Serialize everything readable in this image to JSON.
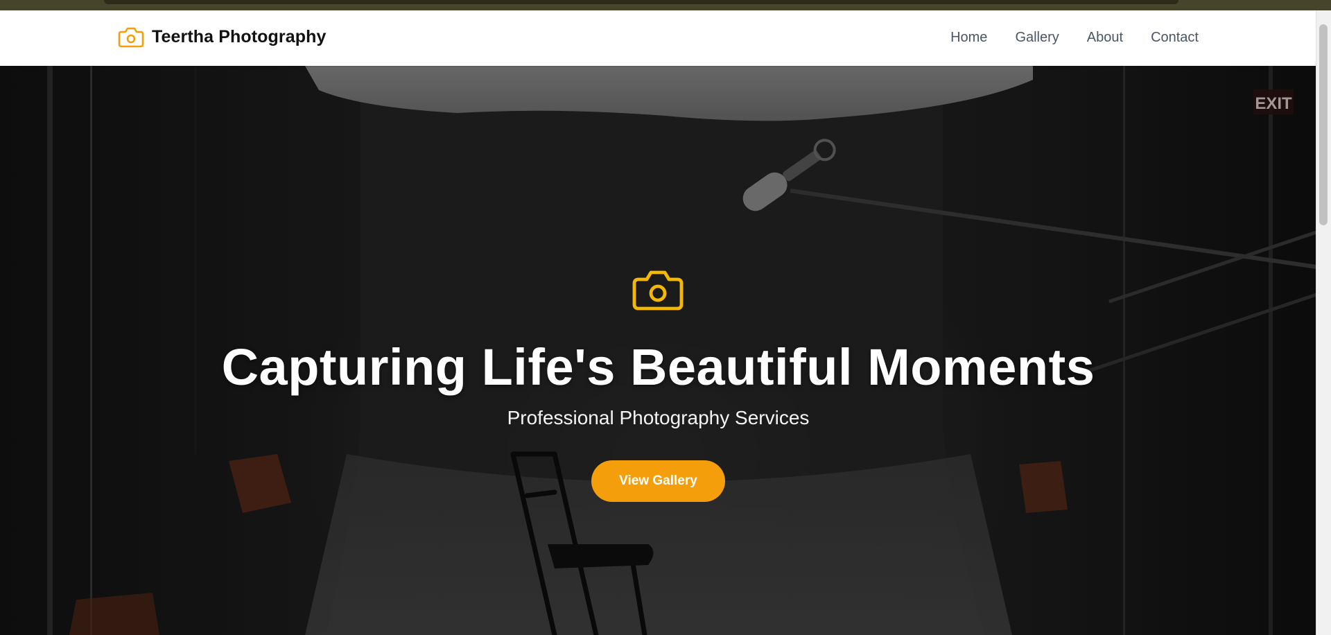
{
  "colors": {
    "accent": "#f59e0b",
    "navbar_bg": "#ffffff",
    "nav_text": "#4b5563",
    "hero_text": "#ffffff"
  },
  "brand": {
    "icon": "camera-icon",
    "name": "Teertha Photography"
  },
  "nav": {
    "items": [
      {
        "label": "Home"
      },
      {
        "label": "Gallery"
      },
      {
        "label": "About"
      },
      {
        "label": "Contact"
      }
    ]
  },
  "hero": {
    "icon": "camera-icon",
    "title": "Capturing Life's Beautiful Moments",
    "subtitle": "Professional Photography Services",
    "cta_label": "View Gallery",
    "exit_sign_text": "EXIT"
  }
}
